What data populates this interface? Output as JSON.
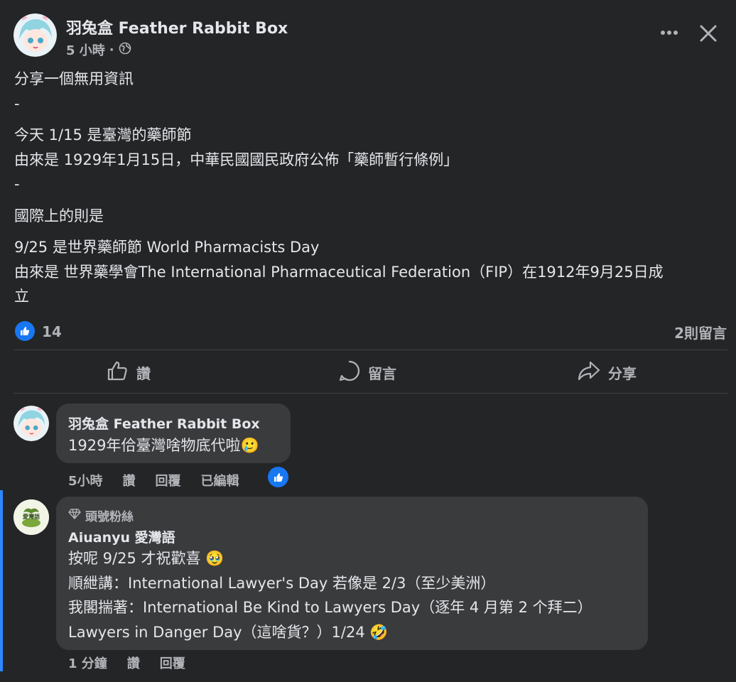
{
  "post": {
    "page_name": "羽兔盒 Feather Rabbit Box",
    "timestamp": "5 小時",
    "separator": "·",
    "lines": [
      "分享一個無用資訊",
      "-",
      "今天 1/15 是臺灣的藥師節",
      "由來是 1929年1月15日，中華民國國民政府公佈「藥師暫行條例」",
      "-",
      "國際上的則是",
      "9/25 是世界藥師節 World Pharmacists Day",
      "由來是 世界藥學會The International Pharmaceutical Federation（FIP）在1912年9月25日成",
      "立"
    ],
    "reaction_count": "14",
    "comment_count": "2則留言"
  },
  "actions": {
    "like": "讚",
    "comment": "留言",
    "share": "分享"
  },
  "comments": [
    {
      "author": "羽兔盒 Feather Rabbit Box",
      "text": "1929年佮臺灣啥物底代啦",
      "emoji": "🥲",
      "time": "5小時",
      "like": "讚",
      "reply": "回覆",
      "edited": "已編輯"
    },
    {
      "badge": "頭號粉絲",
      "author": "Aiuanyu 愛灣語",
      "avatar_text": "愛灣語",
      "lines": [
        "按呢 9/25 才祝歡喜 🥹",
        "順紲講：International Lawyer's Day 若像是 2/3（至少美洲）",
        "我閣揣著：International Be Kind to Lawyers Day（逐年 4 月第 2 个拜二）",
        "Lawyers in Danger Day（這啥貨？）1/24 🤣"
      ],
      "time": "1 分鐘",
      "like": "讚",
      "reply": "回覆"
    }
  ],
  "colors": {
    "background": "#242526",
    "bubble": "#3a3b3c",
    "accent_blue": "#1877f2",
    "text_primary": "#e4e6eb",
    "text_secondary": "#b0b3b8"
  }
}
